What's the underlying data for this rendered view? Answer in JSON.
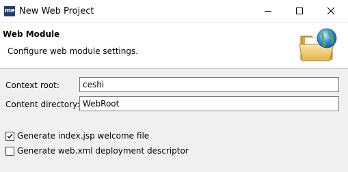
{
  "window": {
    "app_icon_text": "me",
    "title": "New Web Project"
  },
  "header": {
    "title": "Web Module",
    "description": "Configure web module settings.",
    "icon": "folder-globe-icon"
  },
  "form": {
    "context_root": {
      "label": "Context root:",
      "value": "ceshi"
    },
    "content_directory": {
      "label": "Content directory:",
      "value": "WebRoot"
    }
  },
  "options": {
    "generate_index_jsp": {
      "label": "Generate index.jsp welcome file",
      "checked": true
    },
    "generate_web_xml": {
      "label": "Generate web.xml deployment descriptor",
      "checked": false
    }
  }
}
